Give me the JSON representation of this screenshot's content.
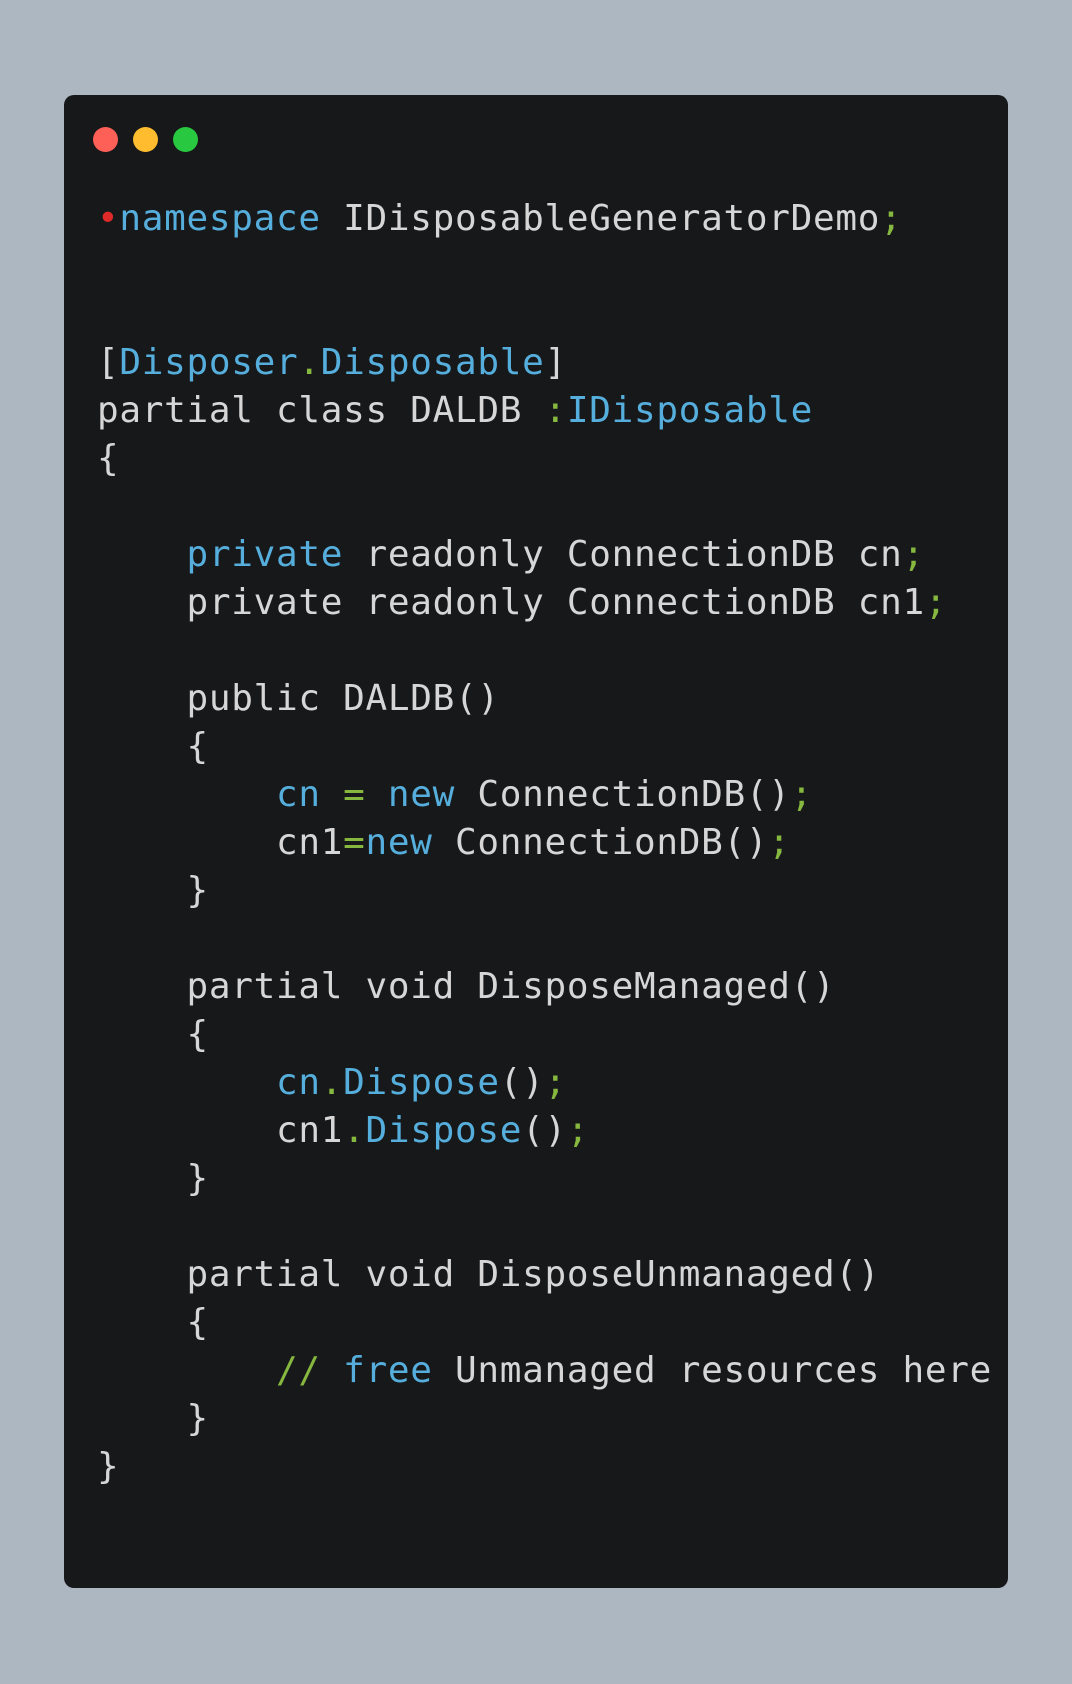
{
  "window": {
    "controls": [
      {
        "name": "close",
        "color": "#fe5f57"
      },
      {
        "name": "minimize",
        "color": "#febc2e"
      },
      {
        "name": "maximize",
        "color": "#28c840"
      }
    ]
  },
  "colors": {
    "background": "#adb7c1",
    "editor_background": "#17181a",
    "default_text": "#d6d6d6",
    "keyword": "#55aedc",
    "punctuation": "#86b73f",
    "breakpoint_marker": "#e02a2a"
  },
  "code_lines": [
    [
      {
        "c": "m",
        "t": "•"
      },
      {
        "c": "k",
        "t": "namespace"
      },
      {
        "c": "t",
        "t": " IDisposableGeneratorDemo"
      },
      {
        "c": "p",
        "t": ";"
      }
    ],
    [],
    [],
    [
      {
        "c": "t",
        "t": "["
      },
      {
        "c": "k",
        "t": "Disposer"
      },
      {
        "c": "p",
        "t": "."
      },
      {
        "c": "k",
        "t": "Disposable"
      },
      {
        "c": "t",
        "t": "]"
      }
    ],
    [
      {
        "c": "t",
        "t": "partial class DALDB "
      },
      {
        "c": "p",
        "t": ":"
      },
      {
        "c": "k",
        "t": "IDisposable"
      }
    ],
    [
      {
        "c": "t",
        "t": "{"
      }
    ],
    [],
    [
      {
        "c": "t",
        "t": "    "
      },
      {
        "c": "k",
        "t": "private"
      },
      {
        "c": "t",
        "t": " readonly ConnectionDB cn"
      },
      {
        "c": "p",
        "t": ";"
      }
    ],
    [
      {
        "c": "t",
        "t": "    private readonly ConnectionDB cn1"
      },
      {
        "c": "p",
        "t": ";"
      }
    ],
    [],
    [
      {
        "c": "t",
        "t": "    public DALDB()"
      }
    ],
    [
      {
        "c": "t",
        "t": "    {"
      }
    ],
    [
      {
        "c": "t",
        "t": "        "
      },
      {
        "c": "k",
        "t": "cn"
      },
      {
        "c": "t",
        "t": " "
      },
      {
        "c": "p",
        "t": "="
      },
      {
        "c": "t",
        "t": " "
      },
      {
        "c": "k",
        "t": "new"
      },
      {
        "c": "t",
        "t": " ConnectionDB()"
      },
      {
        "c": "p",
        "t": ";"
      }
    ],
    [
      {
        "c": "t",
        "t": "        cn1"
      },
      {
        "c": "p",
        "t": "="
      },
      {
        "c": "k",
        "t": "new"
      },
      {
        "c": "t",
        "t": " ConnectionDB()"
      },
      {
        "c": "p",
        "t": ";"
      }
    ],
    [
      {
        "c": "t",
        "t": "    }"
      }
    ],
    [],
    [
      {
        "c": "t",
        "t": "    partial void DisposeManaged()"
      }
    ],
    [
      {
        "c": "t",
        "t": "    {"
      }
    ],
    [
      {
        "c": "t",
        "t": "        "
      },
      {
        "c": "k",
        "t": "cn"
      },
      {
        "c": "p",
        "t": "."
      },
      {
        "c": "k",
        "t": "Dispose"
      },
      {
        "c": "t",
        "t": "()"
      },
      {
        "c": "p",
        "t": ";"
      }
    ],
    [
      {
        "c": "t",
        "t": "        cn1"
      },
      {
        "c": "p",
        "t": "."
      },
      {
        "c": "k",
        "t": "Dispose"
      },
      {
        "c": "t",
        "t": "()"
      },
      {
        "c": "p",
        "t": ";"
      }
    ],
    [
      {
        "c": "t",
        "t": "    }"
      }
    ],
    [],
    [
      {
        "c": "t",
        "t": "    partial void DisposeUnmanaged()"
      }
    ],
    [
      {
        "c": "t",
        "t": "    {"
      }
    ],
    [
      {
        "c": "t",
        "t": "        "
      },
      {
        "c": "p",
        "t": "//"
      },
      {
        "c": "t",
        "t": " "
      },
      {
        "c": "k",
        "t": "free"
      },
      {
        "c": "t",
        "t": " Unmanaged resources here"
      }
    ],
    [
      {
        "c": "t",
        "t": "    }"
      }
    ],
    [
      {
        "c": "t",
        "t": "}"
      }
    ]
  ]
}
